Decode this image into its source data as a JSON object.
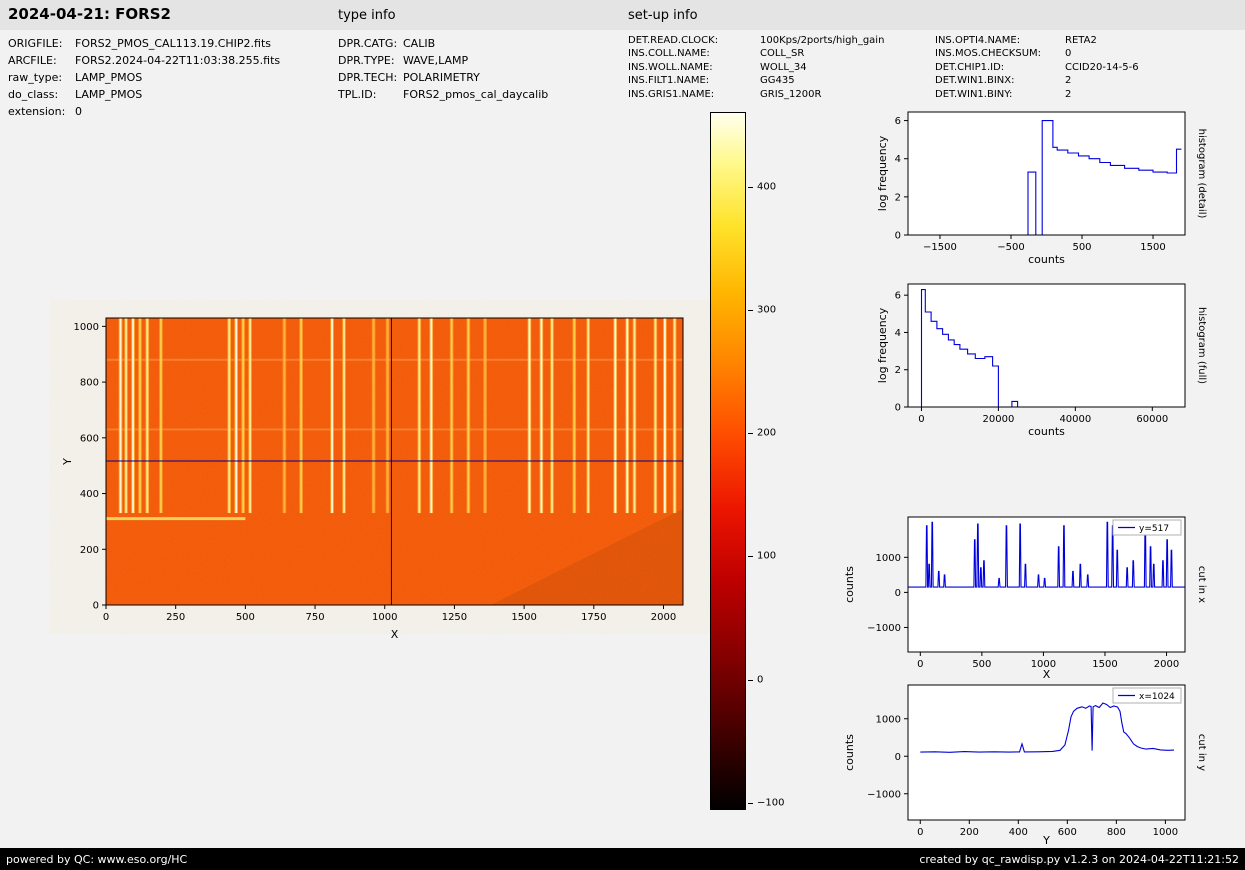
{
  "header": {
    "title": "2024-04-21: FORS2",
    "type_info_label": "type info",
    "setup_info_label": "set-up info"
  },
  "file_info": {
    "rows": [
      {
        "label": "ORIGFILE:",
        "value": "FORS2_PMOS_CAL113.19.CHIP2.fits"
      },
      {
        "label": "ARCFILE:",
        "value": "FORS2.2024-04-22T11:03:38.255.fits"
      },
      {
        "label": "raw_type:",
        "value": "LAMP_PMOS"
      },
      {
        "label": "do_class:",
        "value": "LAMP_PMOS"
      },
      {
        "label": "extension:",
        "value": "0"
      }
    ]
  },
  "type_info": {
    "rows": [
      {
        "label": "DPR.CATG:",
        "value": "CALIB"
      },
      {
        "label": "DPR.TYPE:",
        "value": "WAVE,LAMP"
      },
      {
        "label": "DPR.TECH:",
        "value": "POLARIMETRY"
      },
      {
        "label": "TPL.ID:",
        "value": "FORS2_pmos_cal_daycalib"
      }
    ]
  },
  "setup_info": {
    "col1": [
      {
        "label": "DET.READ.CLOCK:",
        "value": "100Kps/2ports/high_gain"
      },
      {
        "label": "INS.COLL.NAME:",
        "value": "COLL_SR"
      },
      {
        "label": "INS.WOLL.NAME:",
        "value": "WOLL_34"
      },
      {
        "label": "INS.FILT1.NAME:",
        "value": "GG435"
      },
      {
        "label": "INS.GRIS1.NAME:",
        "value": "GRIS_1200R"
      }
    ],
    "col2": [
      {
        "label": "INS.OPTI4.NAME:",
        "value": "RETA2"
      },
      {
        "label": "INS.MOS.CHECKSUM:",
        "value": "0"
      },
      {
        "label": "DET.CHIP1.ID:",
        "value": "CCID20-14-5-6"
      },
      {
        "label": "DET.WIN1.BINX:",
        "value": "2"
      },
      {
        "label": "DET.WIN1.BINY:",
        "value": "2"
      }
    ]
  },
  "footer": {
    "left": "powered by QC: www.eso.org/HC",
    "right": "created by qc_rawdisp.py v1.2.3 on 2024-04-22T11:21:52"
  },
  "chart_data": [
    {
      "id": "raw_image",
      "type": "heatmap",
      "xlabel": "X",
      "ylabel": "Y",
      "xlim": [
        0,
        2070
      ],
      "ylim": [
        0,
        1030
      ],
      "xticks": [
        0,
        250,
        500,
        750,
        1000,
        1250,
        1500,
        1750,
        2000
      ],
      "yticks": [
        0,
        200,
        400,
        600,
        800,
        1000
      ],
      "background_value": 180,
      "colors": {
        "base": "#f25708",
        "corner_shade": "#c84a04"
      },
      "crosshair": {
        "x": 1024,
        "y": 517,
        "color": "#00008b"
      },
      "arc_region": {
        "y_min": 330,
        "y_max": 1030
      },
      "horizontal_line": {
        "y": 310,
        "x_min": 0,
        "x_max": 500,
        "color": "#e8e86a"
      },
      "faint_rows": [
        630,
        880
      ],
      "arc_lines": [
        [
          52,
          0.95
        ],
        [
          72,
          0.7
        ],
        [
          97,
          1.0
        ],
        [
          122,
          0.6
        ],
        [
          148,
          0.85
        ],
        [
          197,
          0.5
        ],
        [
          442,
          0.8
        ],
        [
          467,
          0.95
        ],
        [
          492,
          0.6
        ],
        [
          517,
          0.75
        ],
        [
          640,
          0.4
        ],
        [
          700,
          0.55
        ],
        [
          811,
          0.9
        ],
        [
          854,
          0.7
        ],
        [
          960,
          0.45
        ],
        [
          1010,
          0.35
        ],
        [
          1124,
          0.8
        ],
        [
          1167,
          0.95
        ],
        [
          1240,
          0.5
        ],
        [
          1300,
          0.65
        ],
        [
          1360,
          0.45
        ],
        [
          1519,
          1.0
        ],
        [
          1562,
          0.9
        ],
        [
          1600,
          0.85
        ],
        [
          1680,
          0.6
        ],
        [
          1730,
          0.7
        ],
        [
          1827,
          1.0
        ],
        [
          1870,
          0.95
        ],
        [
          1896,
          0.8
        ],
        [
          1971,
          0.7
        ],
        [
          2005,
          0.95
        ],
        [
          2040,
          0.85
        ]
      ]
    },
    {
      "id": "colorbar",
      "type": "colorbar",
      "vmin": -106,
      "vmax": 461,
      "ticks": [
        -100,
        0,
        100,
        200,
        300,
        400
      ],
      "colormap": "hot"
    },
    {
      "id": "hist_detail",
      "type": "line",
      "xlabel": "counts",
      "ylabel": "log frequency",
      "right_label": "histogram (detail)",
      "color": "#0000dd",
      "xlim": [
        -1950,
        1950
      ],
      "ylim": [
        0,
        6.45
      ],
      "xticks": [
        -1500,
        -500,
        500,
        1500
      ],
      "yticks": [
        0,
        2,
        4,
        6
      ],
      "x": [
        -320,
        -260,
        -260,
        -150,
        -150,
        -60,
        -60,
        90,
        90,
        150,
        150,
        300,
        300,
        450,
        450,
        600,
        600,
        750,
        750,
        900,
        900,
        1100,
        1100,
        1300,
        1300,
        1500,
        1500,
        1700,
        1700,
        1830,
        1830,
        1900
      ],
      "y": [
        0,
        0,
        3.3,
        3.3,
        0,
        0,
        6.0,
        6.0,
        4.6,
        4.6,
        4.45,
        4.45,
        4.3,
        4.3,
        4.15,
        4.15,
        4.0,
        4.0,
        3.8,
        3.8,
        3.65,
        3.65,
        3.5,
        3.5,
        3.4,
        3.4,
        3.3,
        3.3,
        3.25,
        3.25,
        4.5,
        4.5
      ]
    },
    {
      "id": "hist_full",
      "type": "line",
      "xlabel": "counts",
      "ylabel": "log frequency",
      "right_label": "histogram (full)",
      "color": "#0000dd",
      "xlim": [
        -3500,
        68500
      ],
      "ylim": [
        0,
        6.6
      ],
      "xticks": [
        0,
        20000,
        40000,
        60000
      ],
      "yticks": [
        0,
        2,
        4,
        6
      ],
      "x": [
        -500,
        0,
        0,
        1000,
        1000,
        2500,
        2500,
        4000,
        4000,
        5500,
        5500,
        7000,
        7000,
        8500,
        8500,
        10000,
        10000,
        12000,
        12000,
        14000,
        14000,
        16500,
        16500,
        18500,
        18500,
        20000,
        20000,
        23500,
        23500,
        25000,
        25000
      ],
      "y": [
        0,
        0,
        6.3,
        6.3,
        5.1,
        5.1,
        4.6,
        4.6,
        4.2,
        4.2,
        3.9,
        3.9,
        3.6,
        3.6,
        3.35,
        3.35,
        3.1,
        3.1,
        2.85,
        2.85,
        2.6,
        2.6,
        2.7,
        2.7,
        2.2,
        2.2,
        0,
        0,
        0.3,
        0.3,
        0
      ]
    },
    {
      "id": "cut_x",
      "type": "line",
      "xlabel": "X",
      "ylabel": "counts",
      "right_label": "cut in x",
      "legend": "y=517",
      "color": "#0000dd",
      "xlim": [
        -100,
        2150
      ],
      "ylim": [
        -1700,
        2150
      ],
      "xticks": [
        0,
        500,
        1000,
        1500,
        2000
      ],
      "yticks": [
        -1000,
        0,
        1000
      ],
      "baseline": 150,
      "spikes": [
        [
          52,
          1900
        ],
        [
          72,
          800
        ],
        [
          97,
          2000
        ],
        [
          150,
          600
        ],
        [
          197,
          500
        ],
        [
          442,
          1500
        ],
        [
          467,
          1950
        ],
        [
          492,
          700
        ],
        [
          517,
          900
        ],
        [
          640,
          400
        ],
        [
          700,
          1900
        ],
        [
          811,
          1950
        ],
        [
          854,
          800
        ],
        [
          960,
          500
        ],
        [
          1010,
          400
        ],
        [
          1124,
          1300
        ],
        [
          1167,
          1900
        ],
        [
          1240,
          600
        ],
        [
          1300,
          800
        ],
        [
          1360,
          500
        ],
        [
          1519,
          2000
        ],
        [
          1562,
          1900
        ],
        [
          1600,
          1200
        ],
        [
          1680,
          700
        ],
        [
          1730,
          900
        ],
        [
          1827,
          1950
        ],
        [
          1870,
          1300
        ],
        [
          1896,
          800
        ],
        [
          1971,
          900
        ],
        [
          2005,
          1500
        ],
        [
          2040,
          1200
        ]
      ]
    },
    {
      "id": "cut_y",
      "type": "line",
      "xlabel": "Y",
      "ylabel": "counts",
      "right_label": "cut in y",
      "legend": "x=1024",
      "color": "#0000dd",
      "xlim": [
        -50,
        1080
      ],
      "ylim": [
        -1700,
        1900
      ],
      "xticks": [
        0,
        200,
        400,
        600,
        800,
        1000
      ],
      "yticks": [
        -1000,
        0,
        1000
      ],
      "points": [
        [
          0,
          110
        ],
        [
          60,
          120
        ],
        [
          120,
          105
        ],
        [
          180,
          125
        ],
        [
          240,
          110
        ],
        [
          300,
          120
        ],
        [
          360,
          110
        ],
        [
          405,
          115
        ],
        [
          415,
          330
        ],
        [
          425,
          115
        ],
        [
          480,
          120
        ],
        [
          540,
          130
        ],
        [
          570,
          160
        ],
        [
          590,
          300
        ],
        [
          605,
          700
        ],
        [
          615,
          1050
        ],
        [
          625,
          1200
        ],
        [
          640,
          1280
        ],
        [
          660,
          1320
        ],
        [
          675,
          1280
        ],
        [
          690,
          1340
        ],
        [
          697,
          1330
        ],
        [
          701,
          150
        ],
        [
          705,
          1320
        ],
        [
          715,
          1350
        ],
        [
          730,
          1300
        ],
        [
          745,
          1420
        ],
        [
          760,
          1380
        ],
        [
          775,
          1300
        ],
        [
          790,
          1340
        ],
        [
          805,
          1310
        ],
        [
          815,
          1200
        ],
        [
          822,
          900
        ],
        [
          830,
          650
        ],
        [
          840,
          600
        ],
        [
          855,
          480
        ],
        [
          870,
          330
        ],
        [
          885,
          260
        ],
        [
          900,
          220
        ],
        [
          920,
          190
        ],
        [
          950,
          210
        ],
        [
          980,
          170
        ],
        [
          1010,
          160
        ],
        [
          1035,
          165
        ]
      ]
    }
  ]
}
